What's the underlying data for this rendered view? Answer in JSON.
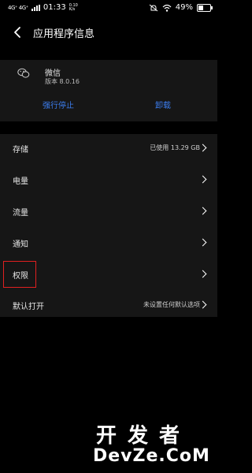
{
  "status_bar": {
    "signal_label": "4G⁺ 4G⁺",
    "time": "01:33",
    "speed": "0.10",
    "speed_unit": "K/s",
    "battery": "49%"
  },
  "header": {
    "title": "应用程序信息"
  },
  "app": {
    "name": "微信",
    "version": "版本 8.0.16",
    "force_stop_label": "强行停止",
    "uninstall_label": "卸载"
  },
  "menu": [
    {
      "label": "存储",
      "value": "已使用 13.29 GB"
    },
    {
      "label": "电量",
      "value": ""
    },
    {
      "label": "流量",
      "value": ""
    },
    {
      "label": "通知",
      "value": ""
    },
    {
      "label": "权限",
      "value": ""
    },
    {
      "label": "默认打开",
      "value": "未设置任何默认选项"
    }
  ],
  "watermark": {
    "line1": "开发者",
    "line2": "DevZe.CoM"
  },
  "colors": {
    "accent": "#3c7ef0",
    "highlight": "#e02020",
    "card_bg": "#161616"
  }
}
